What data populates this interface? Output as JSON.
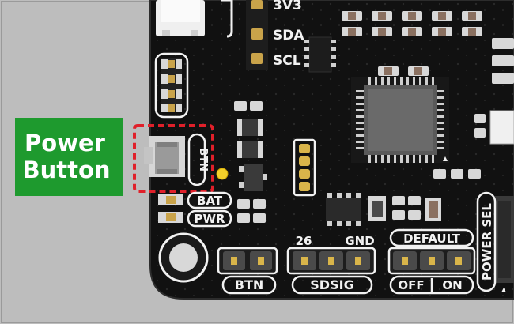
{
  "callout": {
    "line1": "Power",
    "line2": "Button",
    "color": "#1e9a2e"
  },
  "switch_silk": "BTN",
  "led_labels": {
    "bat": "BAT",
    "pwr": "PWR"
  },
  "i2c_labels": {
    "top": "3V3",
    "sda": "SDA",
    "scl": "SCL"
  },
  "headers": {
    "btn": {
      "label": "BTN"
    },
    "sdsig": {
      "label": "SDSIG",
      "left": "26",
      "right": "GND"
    },
    "default": {
      "label": "DEFAULT",
      "left": "OFF",
      "right": "ON"
    }
  },
  "power_sel": "POWER SEL",
  "colors": {
    "board": "#111111",
    "silkscreen": "#f2f2f2",
    "pad": "#d9b54a",
    "highlight": "#e0202a",
    "background": "#bdbdbd"
  }
}
